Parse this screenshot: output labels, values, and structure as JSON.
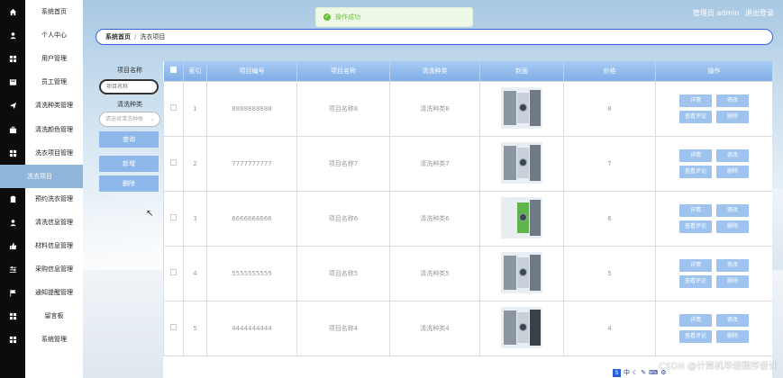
{
  "sidebar": {
    "items": [
      {
        "label": "系统首页",
        "icon": "home-icon"
      },
      {
        "label": "个人中心",
        "icon": "user-icon"
      },
      {
        "label": "用户管理",
        "icon": "grid-icon"
      },
      {
        "label": "员工管理",
        "icon": "card-icon"
      },
      {
        "label": "清洗种类管理",
        "icon": "send-icon"
      },
      {
        "label": "清洗颜色管理",
        "icon": "briefcase-icon"
      },
      {
        "label": "洗衣项目管理",
        "icon": "grid-icon"
      },
      {
        "label": "洗衣项目",
        "icon": "",
        "active": true
      },
      {
        "label": "预约洗衣管理",
        "icon": "clipboard-icon"
      },
      {
        "label": "清洗信息管理",
        "icon": "user-icon"
      },
      {
        "label": "材料信息管理",
        "icon": "thumbs-up-icon"
      },
      {
        "label": "采购信息管理",
        "icon": "sliders-icon"
      },
      {
        "label": "通知提醒管理",
        "icon": "flag-icon"
      },
      {
        "label": "留言板",
        "icon": "grid-icon"
      },
      {
        "label": "系统管理",
        "icon": "grid-icon"
      }
    ]
  },
  "header": {
    "admin_text": "管理员 admin",
    "logout": "退出登录"
  },
  "toast": {
    "message": "操作成功"
  },
  "breadcrumb": {
    "home": "系统首页",
    "current": "洗衣项目"
  },
  "search": {
    "name_label": "项目名称",
    "name_placeholder": "项目名称",
    "type_label": "清洗种类",
    "type_placeholder": "请选择清洗种类",
    "query_button": "查询",
    "add_button": "新增",
    "delete_button": "删除"
  },
  "table": {
    "columns": [
      "",
      "索引",
      "项目编号",
      "项目名称",
      "清洗种类",
      "封面",
      "价格",
      "操作"
    ],
    "rows": [
      {
        "index": "1",
        "code": "8888888888",
        "name": "项目名称8",
        "type": "清洗种类8",
        "price": "8",
        "photo": "plain"
      },
      {
        "index": "2",
        "code": "7777777777",
        "name": "项目名称7",
        "type": "清洗种类7",
        "price": "7",
        "photo": "plain"
      },
      {
        "index": "3",
        "code": "6666666666",
        "name": "项目名称6",
        "type": "清洗种类6",
        "price": "6",
        "photo": "green"
      },
      {
        "index": "4",
        "code": "5555555555",
        "name": "项目名称5",
        "type": "清洗种类5",
        "price": "5",
        "photo": "plain"
      },
      {
        "index": "5",
        "code": "4444444444",
        "name": "项目名称4",
        "type": "清洗种类4",
        "price": "4",
        "photo": "dark"
      }
    ],
    "actions": {
      "detail": "详情",
      "edit": "修改",
      "reviews": "查看评论",
      "delete": "删除"
    }
  },
  "overlay": {
    "tray_text": "中",
    "watermark": "CSDN @计算机毕设程序设计"
  }
}
